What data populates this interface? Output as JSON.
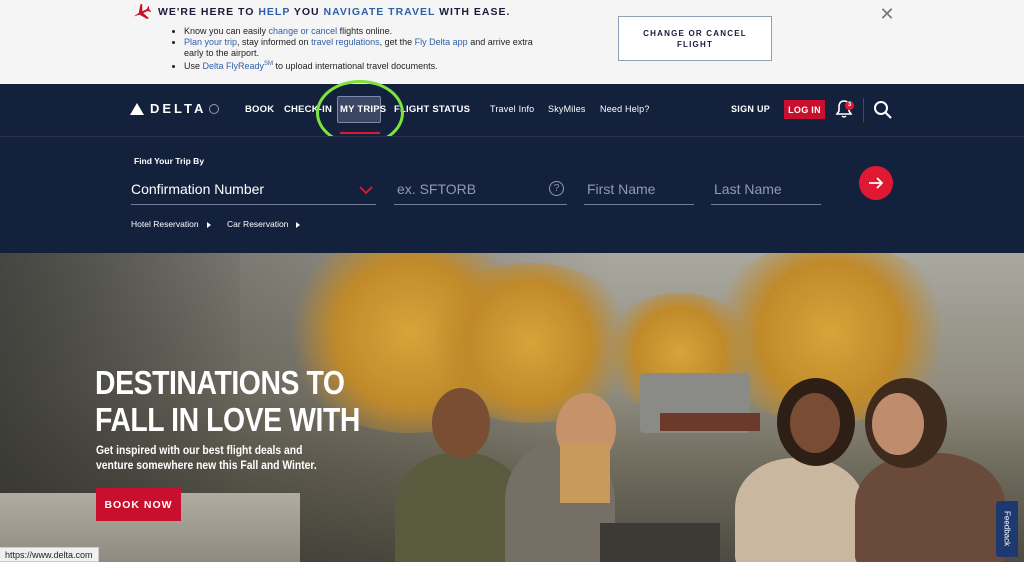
{
  "banner": {
    "title_parts": [
      "WE'RE HERE TO ",
      "HELP",
      " YOU ",
      "NAVIGATE TRAVEL",
      " WITH EASE."
    ],
    "bullet1": {
      "pre": "Know you can easily ",
      "link": "change or cancel",
      "post": " flights online."
    },
    "bullet2": {
      "link1": "Plan your trip",
      "mid1": ", stay informed on ",
      "link2": "travel regulations",
      "mid2": ", get the ",
      "link3": "Fly Delta app",
      "post": " and arrive extra early to the airport."
    },
    "bullet3": {
      "pre": "Use ",
      "link": "Delta FlyReady",
      "sup": "SM",
      "post": " to upload international travel documents."
    },
    "change_button": "CHANGE OR CANCEL FLIGHT"
  },
  "nav": {
    "logo": "DELTA",
    "items": [
      "BOOK",
      "CHECK-IN",
      "MY TRIPS",
      "FLIGHT STATUS"
    ],
    "secondary": [
      "Travel Info",
      "SkyMiles",
      "Need Help?"
    ],
    "signup": "SIGN UP",
    "login": "LOG IN",
    "notification_count": "3"
  },
  "find_trip": {
    "label": "Find Your Trip By",
    "selected_option": "Confirmation Number",
    "confirmation_placeholder": "ex. SFTORB",
    "first_name_placeholder": "First Name",
    "last_name_placeholder": "Last Name",
    "links": [
      "Hotel Reservation",
      "Car Reservation"
    ]
  },
  "hero": {
    "title_line1": "DESTINATIONS TO",
    "title_line2": "FALL IN LOVE WITH",
    "subtitle": "Get inspired with our best flight deals and venture somewhere new this Fall and Winter.",
    "cta": "BOOK NOW"
  },
  "status_bar_url": "https://www.delta.com",
  "feedback_tab": "Feedback",
  "colors": {
    "navy": "#14213d",
    "red": "#c8102e",
    "link_blue": "#2f5fa8",
    "highlight_green": "#7ee43c"
  }
}
